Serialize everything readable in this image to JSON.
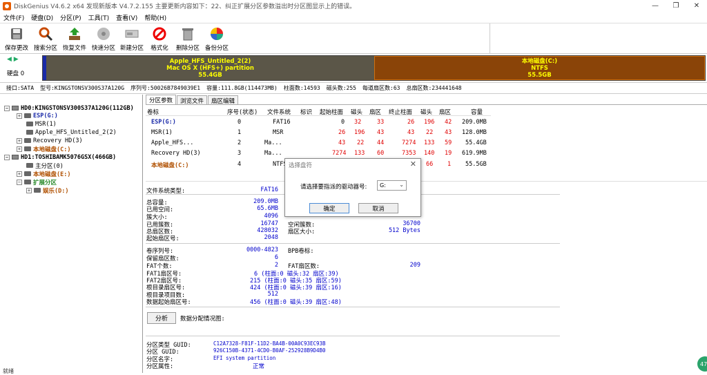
{
  "window": {
    "title": "DiskGenius V4.6.2 x64  发现新版本 V4.7.2.155 主要更新内容如下：22、纠正扩展分区参数溢出时分区图显示上的错误。",
    "minimize": "—",
    "maximize": "❐",
    "close": "✕"
  },
  "menu": [
    "文件(F)",
    "硬盘(D)",
    "分区(P)",
    "工具(T)",
    "查看(V)",
    "帮助(H)"
  ],
  "toolbar": [
    {
      "label": "保存更改",
      "icon": "save-icon"
    },
    {
      "label": "搜索分区",
      "icon": "search-icon"
    },
    {
      "label": "恢复文件",
      "icon": "recover-icon"
    },
    {
      "label": "快速分区",
      "icon": "quick-partition-icon"
    },
    {
      "label": "新建分区",
      "icon": "new-partition-icon"
    },
    {
      "label": "格式化",
      "icon": "format-icon"
    },
    {
      "label": "删除分区",
      "icon": "trash-icon"
    },
    {
      "label": "备份分区",
      "icon": "backup-icon"
    }
  ],
  "diskmap": {
    "disk_label": "硬盘 0",
    "partitions": [
      {
        "line1": "Apple_HFS_Untitled_2(2)",
        "line2": "Mac OS X (HFS+) partition",
        "line3": "55.4GB"
      },
      {
        "line1": "本地磁盘(C:)",
        "line2": "NTFS",
        "line3": "55.5GB"
      }
    ]
  },
  "infobar": {
    "iface": "接口:SATA",
    "model": "型号:KINGSTONSV300S37A120G",
    "serial": "序列号:50026B7849039E1",
    "capacity": "容量:111.8GB(114473MB)",
    "cylinders": "柱面数:14593",
    "heads": "磁头数:255",
    "sectors_per_track": "每道扇区数:63",
    "total_sectors": "总扇区数:234441648"
  },
  "tree": {
    "hd0": "HD0:KINGSTONSV300S37A120G(112GB)",
    "hd0_items": [
      "ESP(G:)",
      "MSR(1)",
      "Apple_HFS_Untitled_2(2)",
      "Recovery HD(3)",
      "本地磁盘(C:)"
    ],
    "hd1": "HD1:TOSHIBAMK5076GSX(466GB)",
    "hd1_items": [
      "主分区(0)",
      "本地磁盘(E:)",
      "扩展分区",
      "娱乐(D:)"
    ]
  },
  "tabs": [
    "分区参数",
    "浏览文件",
    "扇区编辑"
  ],
  "table": {
    "headers": [
      "卷标",
      "序号(状态)",
      "文件系统",
      "标识",
      "起始柱面",
      "磁头",
      "扇区",
      "终止柱面",
      "磁头",
      "扇区",
      "容量"
    ],
    "rows": [
      {
        "label": "ESP(G:)",
        "idx": "0",
        "fs": "FAT16",
        "sc": "0",
        "sh": "32",
        "ss": "33",
        "ec": "26",
        "eh": "196",
        "es": "42",
        "cap": "209.0MB"
      },
      {
        "label": "MSR(1)",
        "idx": "1",
        "fs": "MSR",
        "sc": "26",
        "sh": "196",
        "ss": "43",
        "ec": "43",
        "eh": "22",
        "es": "43",
        "cap": "128.0MB"
      },
      {
        "label": "Apple_HFS...",
        "idx": "2",
        "fs": "Ma...",
        "sc": "43",
        "sh": "22",
        "ss": "44",
        "ec": "7274",
        "eh": "133",
        "es": "59",
        "cap": "55.4GB"
      },
      {
        "label": "Recovery HD(3)",
        "idx": "3",
        "fs": "Ma...",
        "sc": "7274",
        "sh": "133",
        "ss": "60",
        "ec": "7353",
        "eh": "140",
        "es": "19",
        "cap": "619.9MB"
      },
      {
        "label": "本地磁盘(C:)",
        "idx": "4",
        "fs": "NTFS",
        "sc": "",
        "sh": "",
        "ss": "",
        "ec": "",
        "eh": "66",
        "es": "1",
        "cap": "55.5GB"
      }
    ]
  },
  "details": {
    "fs_type_label": "文件系统类型:",
    "fs_type": "FAT16",
    "total_cap_label": "总容量:",
    "total_cap": "209.0MB",
    "used_label": "已用空间:",
    "used": "65.6MB",
    "cluster_size_label": "簇大小:",
    "cluster_size": "4096",
    "used_clusters_label": "已用簇数:",
    "used_clusters": "16747",
    "free_clusters_label": "空闲簇数:",
    "free_clusters": "36700",
    "total_sectors_label": "总扇区数:",
    "total_sectors": "428032",
    "sector_size_label": "扇区大小:",
    "sector_size": "512 Bytes",
    "start_sector_label": "起始扇区号:",
    "start_sector": "2048",
    "vol_serial_label": "卷序列号:",
    "vol_serial": "0000-4823",
    "bpb_label": "BPB卷标:",
    "reserved_label": "保留扇区数:",
    "reserved": "6",
    "fat_count_label": "FAT个数:",
    "fat_count": "2",
    "fat_sectors_label": "FAT扇区数:",
    "fat_sectors": "209",
    "fat1_label": "FAT1扇区号:",
    "fat1": "6 (柱面:0 磁头:32 扇区:39)",
    "fat2_label": "FAT2扇区号:",
    "fat2": "215 (柱面:0 磁头:35 扇区:59)",
    "root_sector_label": "根目录扇区号:",
    "root_sector": "424 (柱面:0 磁头:39 扇区:16)",
    "root_entries_label": "根目录项目数:",
    "root_entries": "512",
    "data_start_label": "数据起始扇区号:",
    "data_start": "456 (柱面:0 磁头:39 扇区:48)",
    "analyze_button": "分析",
    "data_dist_label": "数据分配情况图:",
    "ptype_guid_label": "分区类型 GUID:",
    "ptype_guid": "C12A7328-F81F-11D2-BA4B-00A0C93EC93B",
    "p_guid_label": "分区 GUID:",
    "p_guid": "926C150B-4371-4CD0-B0AF-252928B9D4B0",
    "p_name_label": "分区名字:",
    "p_name": "EFI system partition",
    "p_attr_label": "分区属性:",
    "p_attr": "正常"
  },
  "dialog": {
    "title": "选择盘符",
    "close": "✕",
    "prompt": "请选择要指派的驱动器号:",
    "selected": "G:",
    "ok": "确定",
    "cancel": "取消"
  },
  "status": {
    "text": "就绪",
    "badge": "47"
  }
}
